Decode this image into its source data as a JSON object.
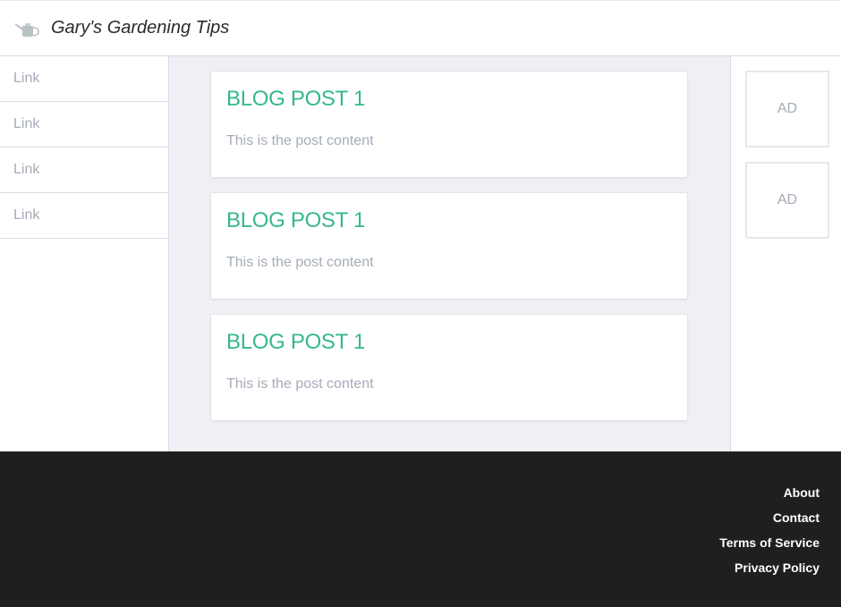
{
  "header": {
    "title": "Gary's Gardening Tips",
    "logo_icon": "watering-can-icon"
  },
  "sidebar": {
    "links": [
      "Link",
      "Link",
      "Link",
      "Link"
    ]
  },
  "posts": [
    {
      "title": "BLOG POST 1",
      "content": "This is the post content"
    },
    {
      "title": "BLOG POST 1",
      "content": "This is the post content"
    },
    {
      "title": "BLOG POST 1",
      "content": "This is the post content"
    }
  ],
  "ads": [
    "AD",
    "AD"
  ],
  "footer": {
    "links": [
      "About",
      "Contact",
      "Terms of Service",
      "Privacy Policy"
    ]
  },
  "colors": {
    "accent": "#35b98a",
    "muted_text": "#a5acb8",
    "footer_bg": "#1f1f1f",
    "main_bg": "#eff0f5"
  }
}
